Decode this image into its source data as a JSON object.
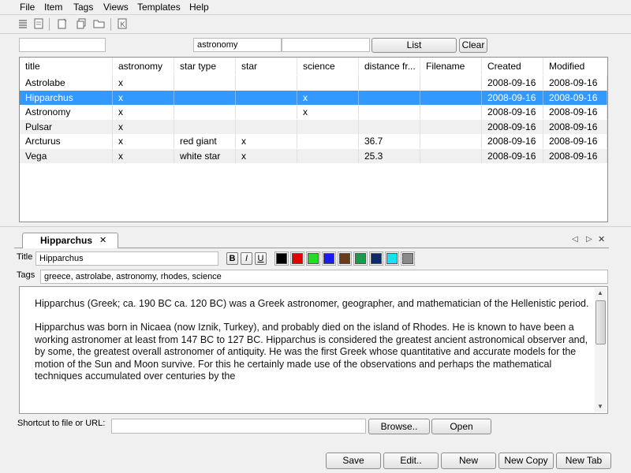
{
  "menu": [
    "File",
    "Item",
    "Tags",
    "Views",
    "Templates",
    "Help"
  ],
  "toolbar_icons": [
    "list-icon",
    "page-icon",
    "new-page-icon",
    "clone-icon",
    "open-folder-icon",
    "k-icon"
  ],
  "search": {
    "field1": "",
    "field2": "astronomy",
    "field3": "",
    "list_label": "List",
    "clear_label": "Clear"
  },
  "table": {
    "headers": [
      "title",
      "astronomy",
      "star type",
      "star",
      "science",
      "distance fr...",
      "Filename",
      "Created",
      "Modified"
    ],
    "rows": [
      [
        "Astrolabe",
        "x",
        "",
        "",
        "",
        "",
        "",
        "2008-09-16",
        "2008-09-16"
      ],
      [
        "Hipparchus",
        "x",
        "",
        "",
        "x",
        "",
        "",
        "2008-09-16",
        "2008-09-16"
      ],
      [
        "Astronomy",
        "x",
        "",
        "",
        "x",
        "",
        "",
        "2008-09-16",
        "2008-09-16"
      ],
      [
        "Pulsar",
        "x",
        "",
        "",
        "",
        "",
        "",
        "2008-09-16",
        "2008-09-16"
      ],
      [
        "Arcturus",
        "x",
        "red giant",
        "x",
        "",
        "36.7",
        "",
        "2008-09-16",
        "2008-09-16"
      ],
      [
        "Vega",
        "x",
        "white star",
        "x",
        "",
        "25.3",
        "",
        "2008-09-16",
        "2008-09-16"
      ]
    ],
    "selected_row": 1
  },
  "tab": {
    "label": "Hipparchus",
    "close": "✕"
  },
  "nav": {
    "prev": "◁",
    "next": "▷",
    "close": "✕"
  },
  "editor": {
    "title_label": "Title",
    "title_value": "Hipparchus",
    "tags_label": "Tags",
    "tags_value": "greece, astrolabe, astronomy, rhodes, science",
    "bold": "B",
    "italic": "I",
    "underline": "U",
    "colors": [
      "#000000",
      "#e00000",
      "#22dd22",
      "#1a1aee",
      "#6b3a1a",
      "#1a9a4a",
      "#0a2a6a",
      "#1ae0ee",
      "#8a8a8a"
    ],
    "body_paragraphs": [
      "Hipparchus (Greek; ca. 190 BC ca. 120 BC) was a Greek astronomer, geographer, and mathematician of the Hellenistic period.",
      "Hipparchus was born in Nicaea (now Iznik, Turkey), and probably died on the island of Rhodes. He is known to have been a working astronomer at least from 147 BC to 127 BC. Hipparchus is considered the greatest ancient astronomical observer and, by some, the greatest overall astronomer of antiquity. He was the first Greek whose quantitative and accurate models for the motion of the Sun and Moon survive. For this he certainly made use of the observations and perhaps the mathematical techniques accumulated over centuries by the"
    ],
    "shortcut_label": "Shortcut to file or URL:",
    "shortcut_value": "",
    "browse_label": "Browse..",
    "open_label": "Open"
  },
  "buttons": {
    "save": "Save",
    "edit": "Edit..",
    "new": "New",
    "new_copy": "New Copy",
    "new_tab": "New Tab"
  }
}
